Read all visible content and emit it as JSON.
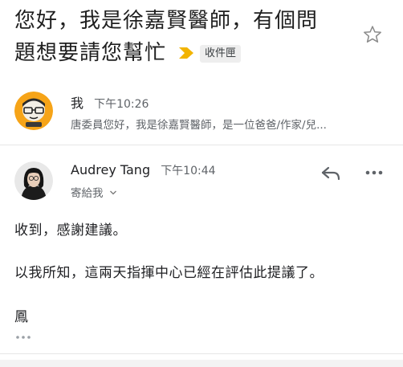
{
  "email": {
    "subject_line1": "您好，我是徐嘉賢醫師，有個問",
    "subject_line2": "題想要請您幫忙",
    "label": "收件匣",
    "star_icon": "star-outline-icon",
    "importance_icon": "importance-marker-icon",
    "importance_color": "#f2b400"
  },
  "messages": [
    {
      "sender": "我",
      "time": "下午10:26",
      "snippet": "唐委員您好，我是徐嘉賢醫師，是一位爸爸/作家/兒...",
      "avatar": "cartoon-avatar"
    },
    {
      "sender": "Audrey Tang",
      "time": "下午10:44",
      "recipient": "寄給我",
      "avatar": "photo-avatar",
      "body": [
        "收到，感謝建議。",
        "以我所知，這兩天指揮中心已經在評估此提議了。",
        "鳳"
      ],
      "actions": {
        "reply_icon": "reply-icon",
        "more_icon": "more-horizontal-icon",
        "trimmed_icon": "show-trimmed-content-icon"
      }
    }
  ]
}
